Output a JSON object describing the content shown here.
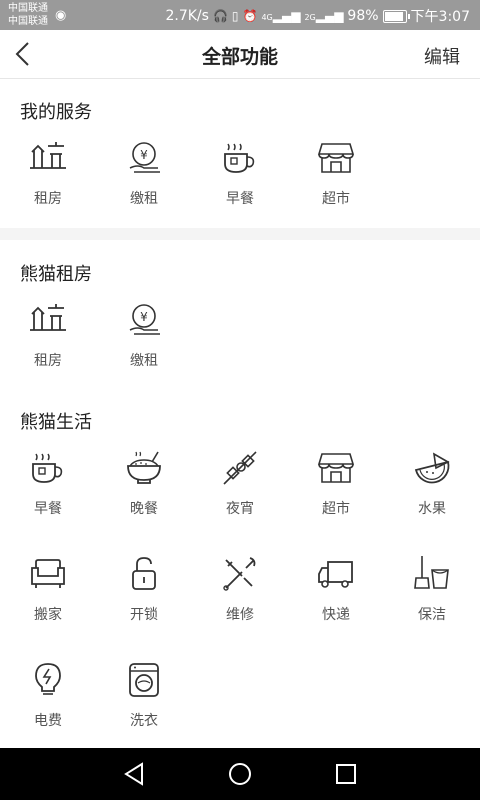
{
  "status_bar": {
    "carrier_line1": "中国联通",
    "carrier_line2": "中国联通",
    "speed": "2.7K/s",
    "signal1": "4G",
    "signal2": "2G",
    "battery": "98%",
    "battery_level": 0.98,
    "time": "下午3:07"
  },
  "nav": {
    "title": "全部功能",
    "edit_label": "编辑"
  },
  "my_services": {
    "title": "我的服务",
    "items": [
      {
        "label": "租房",
        "icon": "house-icon"
      },
      {
        "label": "缴租",
        "icon": "rent-payment-icon"
      },
      {
        "label": "早餐",
        "icon": "breakfast-cup-icon"
      },
      {
        "label": "超市",
        "icon": "store-icon"
      }
    ]
  },
  "panda_rent": {
    "title": "熊猫租房",
    "items": [
      {
        "label": "租房",
        "icon": "house-icon"
      },
      {
        "label": "缴租",
        "icon": "rent-payment-icon"
      }
    ]
  },
  "panda_life": {
    "title": "熊猫生活",
    "items": [
      {
        "label": "早餐",
        "icon": "breakfast-cup-icon"
      },
      {
        "label": "晚餐",
        "icon": "dinner-bowl-icon"
      },
      {
        "label": "夜宵",
        "icon": "skewer-icon"
      },
      {
        "label": "超市",
        "icon": "store-icon"
      },
      {
        "label": "水果",
        "icon": "watermelon-icon"
      },
      {
        "label": "搬家",
        "icon": "sofa-icon"
      },
      {
        "label": "开锁",
        "icon": "unlock-icon"
      },
      {
        "label": "维修",
        "icon": "tools-icon"
      },
      {
        "label": "快递",
        "icon": "truck-icon"
      },
      {
        "label": "保洁",
        "icon": "mop-bucket-icon"
      },
      {
        "label": "电费",
        "icon": "lightbulb-icon"
      },
      {
        "label": "洗衣",
        "icon": "washing-machine-icon"
      }
    ]
  },
  "system_nav": {
    "back": "triangle-back-icon",
    "home": "circle-home-icon",
    "recent": "square-recent-icon"
  }
}
